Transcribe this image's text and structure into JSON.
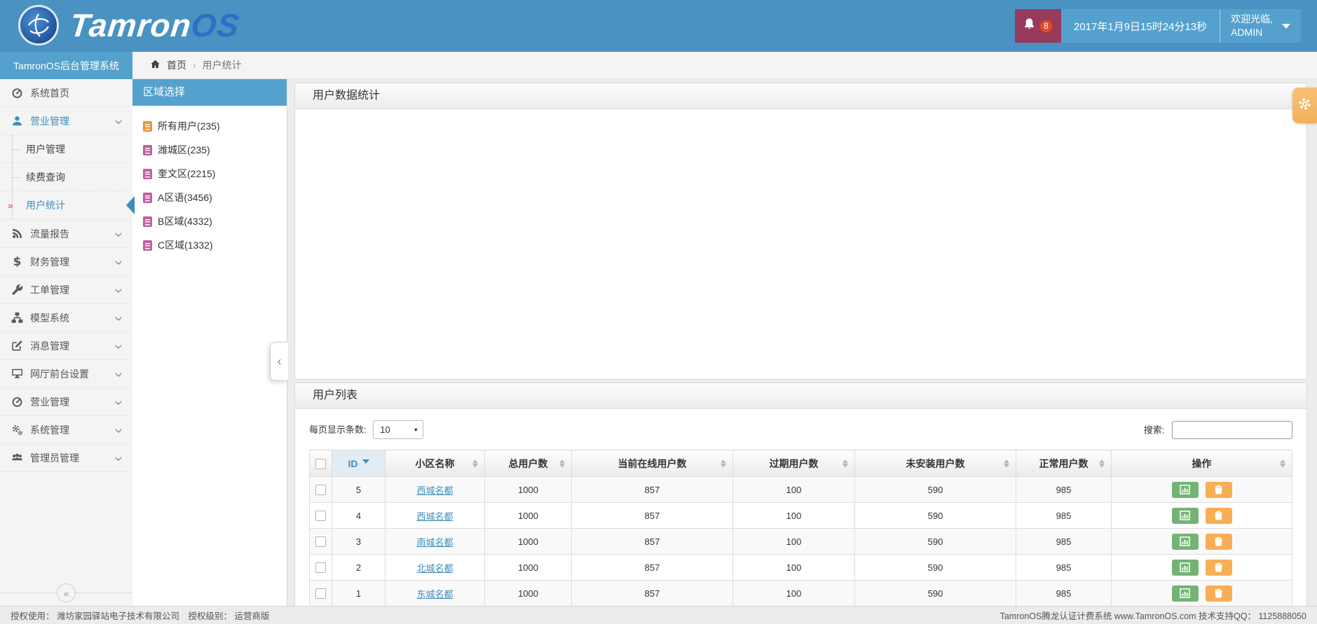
{
  "header": {
    "logo_text_white": "Tamron",
    "logo_text_blue": "OS",
    "notification_count": "8",
    "datetime": "2017年1月9日15时24分13秒",
    "welcome_line1": "欢迎光临,",
    "welcome_line2": "ADMIN"
  },
  "breadcrumb": {
    "home": "首页",
    "separator": "›",
    "current": "用户统计"
  },
  "sidebar": {
    "brand": "TamronOS后台管理系统",
    "items": [
      {
        "label": "系统首页",
        "icon": "dashboard-icon",
        "chevron": false
      },
      {
        "label": "营业管理",
        "icon": "user-icon",
        "chevron": true,
        "active": true,
        "submenu": [
          {
            "label": "用户管理"
          },
          {
            "label": "续费查询"
          },
          {
            "label": "用户统计",
            "active": true
          }
        ]
      },
      {
        "label": "流量报告",
        "icon": "rss-icon",
        "chevron": true
      },
      {
        "label": "财务管理",
        "icon": "dollar-icon",
        "chevron": true
      },
      {
        "label": "工单管理",
        "icon": "wrench-icon",
        "chevron": true
      },
      {
        "label": "模型系统",
        "icon": "sitemap-icon",
        "chevron": true
      },
      {
        "label": "消息管理",
        "icon": "edit-icon",
        "chevron": true
      },
      {
        "label": "网厅前台设置",
        "icon": "desktop-icon",
        "chevron": true
      },
      {
        "label": "营业管理",
        "icon": "gauge-icon",
        "chevron": true
      },
      {
        "label": "系统管理",
        "icon": "gears-icon",
        "chevron": true
      },
      {
        "label": "管理员管理",
        "icon": "users-icon",
        "chevron": true
      }
    ]
  },
  "region_panel": {
    "title": "区域选择",
    "items": [
      {
        "label": "所有用户(235)",
        "icon_color": "#ef9136"
      },
      {
        "label": "潍城区(235)",
        "icon_color": "#c0609f"
      },
      {
        "label": "奎文区(2215)",
        "icon_color": "#c0609f"
      },
      {
        "label": "A区语(3456)",
        "icon_color": "#c0609f"
      },
      {
        "label": "B区域(4332)",
        "icon_color": "#c0609f"
      },
      {
        "label": "C区域(1332)",
        "icon_color": "#c0609f"
      }
    ]
  },
  "stats_panel": {
    "title": "用户数据统计"
  },
  "list_panel": {
    "title": "用户列表",
    "page_size_label": "每页显示条数:",
    "page_size_value": "10",
    "search_label": "搜索:",
    "columns": [
      "ID",
      "小区名称",
      "总用户数",
      "当前在线用户数",
      "过期用户数",
      "未安装用户数",
      "正常用户数",
      "操作"
    ],
    "sorted_column": "ID",
    "sort_direction": "desc",
    "rows": [
      {
        "id": "5",
        "name": "西城名都",
        "total": "1000",
        "online": "857",
        "expired": "100",
        "uninstalled": "590",
        "normal": "985"
      },
      {
        "id": "4",
        "name": "西城名都",
        "total": "1000",
        "online": "857",
        "expired": "100",
        "uninstalled": "590",
        "normal": "985"
      },
      {
        "id": "3",
        "name": "南城名都",
        "total": "1000",
        "online": "857",
        "expired": "100",
        "uninstalled": "590",
        "normal": "985"
      },
      {
        "id": "2",
        "name": "北城名都",
        "total": "1000",
        "online": "857",
        "expired": "100",
        "uninstalled": "590",
        "normal": "985"
      },
      {
        "id": "1",
        "name": "东城名都",
        "total": "1000",
        "online": "857",
        "expired": "100",
        "uninstalled": "590",
        "normal": "985"
      }
    ]
  },
  "footer": {
    "left": "授权使用： 潍坊家园驿站电子技术有限公司　授权级别： 运营商版",
    "right": "TamronOS腾龙认证计费系统 www.TamronOS.com 技术支持QQ： 1125888050"
  },
  "colors": {
    "navbar": "#4a92c2",
    "navbar_light": "#55a1ce",
    "notification_bg": "#963a5e",
    "badge": "#e04b31",
    "accent": "#3c8dbc",
    "logo_os": "#2d6fc3",
    "button_chart": "#74b375",
    "button_delete": "#f8ae54",
    "gear_tab": "#f4b05a"
  }
}
